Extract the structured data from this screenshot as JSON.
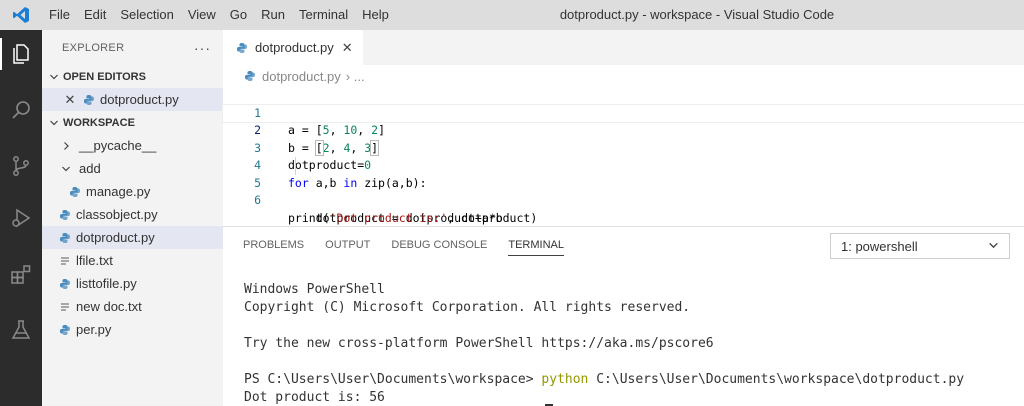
{
  "menu": [
    "File",
    "Edit",
    "Selection",
    "View",
    "Go",
    "Run",
    "Terminal",
    "Help"
  ],
  "window_title": "dotproduct.py - workspace - Visual Studio Code",
  "sidebar": {
    "title": "EXPLORER",
    "more": "···",
    "open_editors_label": "OPEN EDITORS",
    "open_editor_file": "dotproduct.py",
    "workspace_label": "WORKSPACE",
    "items": [
      {
        "label": "__pycache__"
      },
      {
        "label": "add"
      },
      {
        "label": "manage.py"
      },
      {
        "label": "classobject.py"
      },
      {
        "label": "dotproduct.py"
      },
      {
        "label": "lfile.txt"
      },
      {
        "label": "listtofile.py"
      },
      {
        "label": "new doc.txt"
      },
      {
        "label": "per.py"
      }
    ]
  },
  "editor": {
    "tab_label": "dotproduct.py",
    "breadcrumb_file": "dotproduct.py",
    "breadcrumb_sep": "› ...",
    "line_numbers": [
      "1",
      "2",
      "3",
      "4",
      "5",
      "6"
    ]
  },
  "panel": {
    "tabs": [
      "PROBLEMS",
      "OUTPUT",
      "DEBUG CONSOLE",
      "TERMINAL"
    ],
    "terminal_select": "1: powershell",
    "terminal_lines": {
      "l1": "Windows PowerShell",
      "l2": "Copyright (C) Microsoft Corporation. All rights reserved.",
      "l3": "Try the new cross-platform PowerShell https://aka.ms/pscore6",
      "prompt": "PS C:\\Users\\User\\Documents\\workspace> ",
      "cmd": "python",
      "cmd_args": " C:\\Users\\User\\Documents\\workspace\\dotproduct.py",
      "output": "Dot product is: 56"
    }
  },
  "colors": {
    "accent": "#007acc",
    "python_icon": "#4a8bbd",
    "activitybar": "#2c2c2c"
  }
}
